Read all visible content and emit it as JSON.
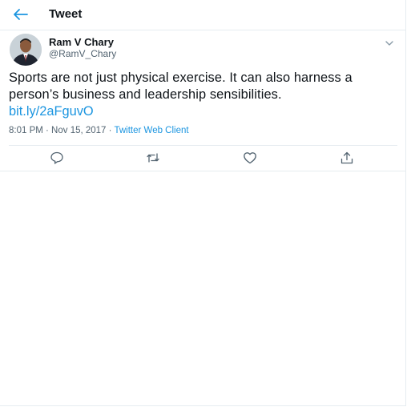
{
  "header": {
    "title": "Tweet",
    "back_icon": "arrow-left-icon"
  },
  "author": {
    "name": "Ram V Chary",
    "handle": "@RamV_Chary"
  },
  "tweet": {
    "text": "Sports are not just physical exercise. It can also harness a person’s business and leadership sensibilities.",
    "link": "bit.ly/2aFguvO",
    "timestamp": "8:01 PM · Nov 15, 2017 · ",
    "client": "Twitter Web Client"
  },
  "actions": [
    "reply-icon",
    "retweet-icon",
    "like-icon",
    "share-icon"
  ],
  "colors": {
    "accent": "#1b95e0",
    "secondary_text": "#536471",
    "border": "#e6ecf0"
  }
}
